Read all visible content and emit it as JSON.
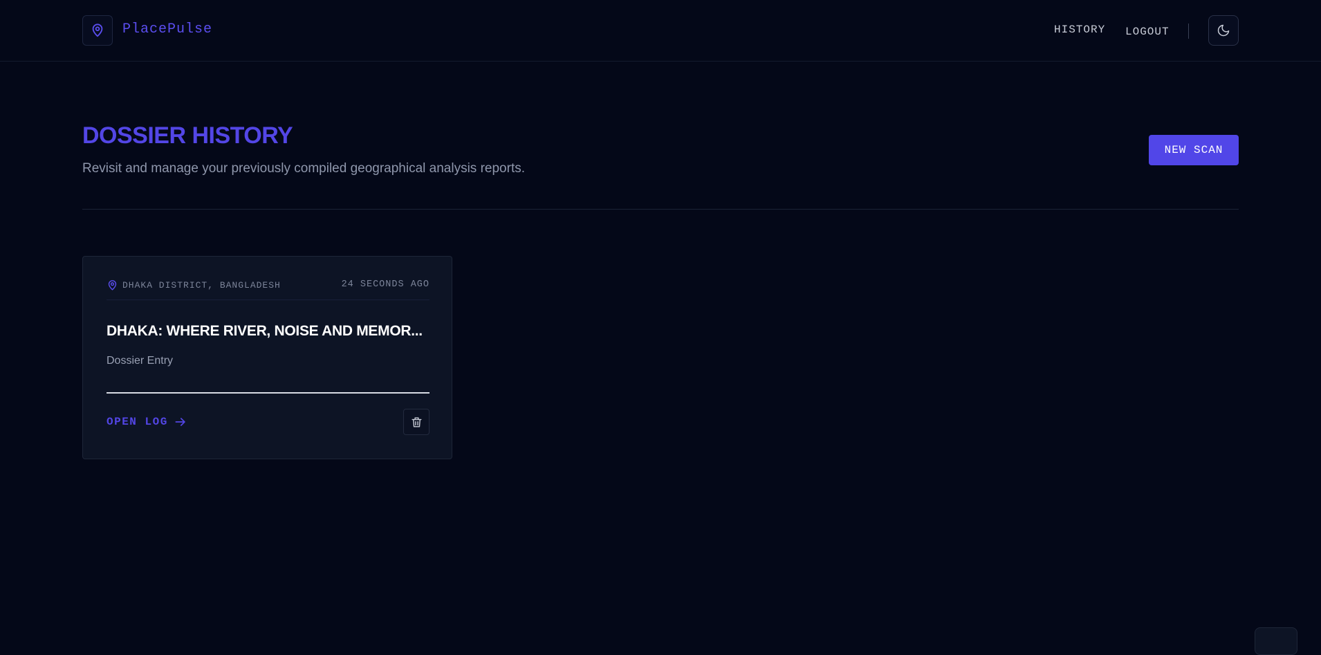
{
  "header": {
    "app_name": "PlacePulse",
    "nav": [
      {
        "label": "HISTORY"
      },
      {
        "label": "LOGOUT"
      }
    ],
    "logo_icon": "map-pin-icon",
    "theme_icon": "moon-icon"
  },
  "page": {
    "title": "DOSSIER HISTORY",
    "subtitle": "Revisit and manage your previously compiled geographical analysis reports.",
    "new_scan_label": "NEW SCAN"
  },
  "cards": [
    {
      "location": "DHAKA DISTRICT, BANGLADESH",
      "time": "24 SECONDS AGO",
      "title": "DHAKA: WHERE RIVER, NOISE AND MEMOR...",
      "subtitle": "Dossier Entry",
      "action_label": "OPEN LOG",
      "action_icon": "arrow-right-icon",
      "delete_icon": "trash-icon"
    }
  ],
  "colors": {
    "background": "#040818",
    "accent": "#5146e8",
    "card": "#0d1425"
  }
}
